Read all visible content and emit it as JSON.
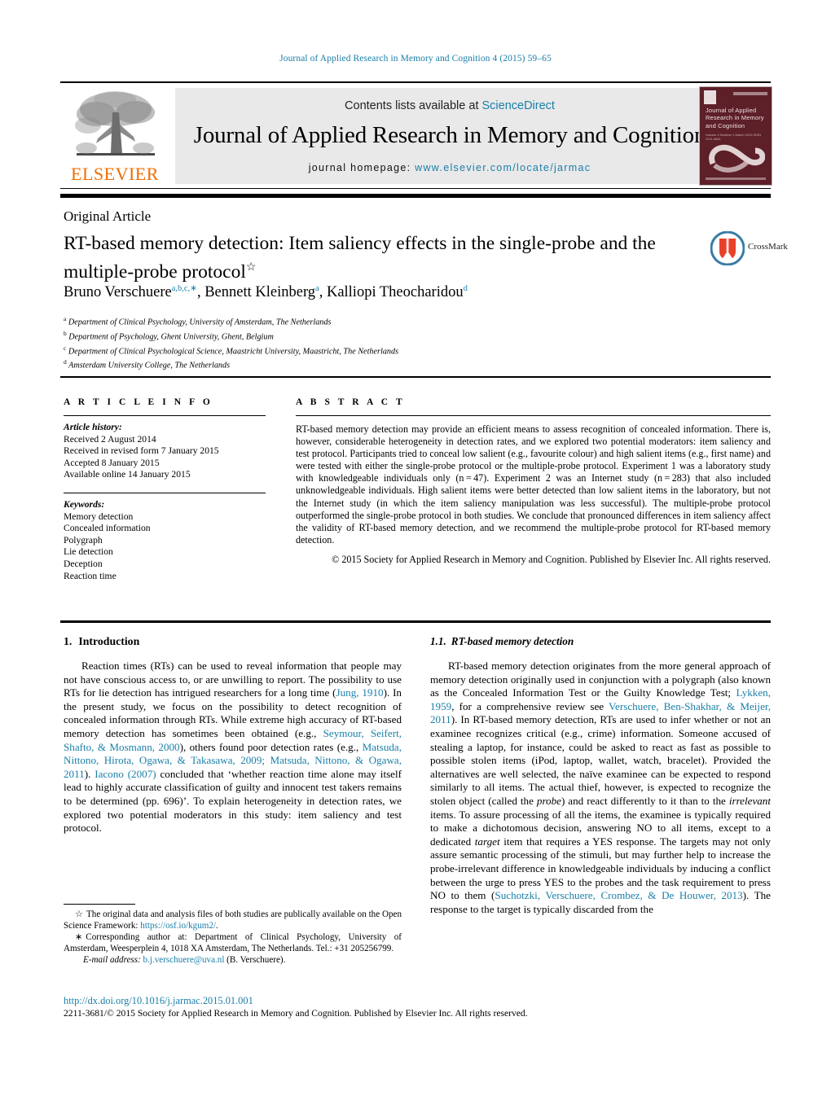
{
  "running_head": "Journal of Applied Research in Memory and Cognition 4 (2015) 59–65",
  "masthead": {
    "contents_prefix": "Contents lists available at ",
    "sciencedirect": "ScienceDirect",
    "journal_title": "Journal of Applied Research in Memory and Cognition",
    "homepage_prefix": "journal homepage: ",
    "homepage_url": "www.elsevier.com/locate/jarmac",
    "elsevier_wordmark": "ELSEVIER",
    "cover": {
      "title": "Journal of Applied Research in Memory and Cognition",
      "label": "Journal of",
      "sub": "Volume 4  Number 1  March 2015\nISSN 2211-3681"
    },
    "colors": {
      "link": "#1a7fa8",
      "elsevier_orange": "#f06c00",
      "panel_bg": "#e9e9e9",
      "cover_bg": "#5d1f28"
    }
  },
  "article": {
    "type": "Original Article",
    "title": "RT-based memory detection: Item saliency effects in the single-probe and the multiple-probe protocol",
    "title_footnote_mark": "☆",
    "crossmark_label": "CrossMark",
    "authors_html": "Bruno Verschuere<sup>a,b,c,∗</sup>, Bennett Kleinberg<sup>a</sup>, Kalliopi Theocharidou<sup>d</sup>",
    "affiliations": [
      {
        "mark": "a",
        "text": "Department of Clinical Psychology, University of Amsterdam, The Netherlands"
      },
      {
        "mark": "b",
        "text": "Department of Psychology, Ghent University, Ghent, Belgium"
      },
      {
        "mark": "c",
        "text": "Department of Clinical Psychological Science, Maastricht University, Maastricht, The Netherlands"
      },
      {
        "mark": "d",
        "text": "Amsterdam University College, The Netherlands"
      }
    ]
  },
  "article_info": {
    "heading": "A R T I C L E   I N F O",
    "history_label": "Article history:",
    "history": [
      "Received 2 August 2014",
      "Received in revised form 7 January 2015",
      "Accepted 8 January 2015",
      "Available online 14 January 2015"
    ],
    "keywords_label": "Keywords:",
    "keywords": [
      "Memory detection",
      "Concealed information",
      "Polygraph",
      "Lie detection",
      "Deception",
      "Reaction time"
    ]
  },
  "abstract": {
    "heading": "A B S T R A C T",
    "body": "RT-based memory detection may provide an efficient means to assess recognition of concealed information. There is, however, considerable heterogeneity in detection rates, and we explored two potential moderators: item saliency and test protocol. Participants tried to conceal low salient (e.g., favourite colour) and high salient items (e.g., first name) and were tested with either the single-probe protocol or the multiple-probe protocol. Experiment 1 was a laboratory study with knowledgeable individuals only (n = 47). Experiment 2 was an Internet study (n = 283) that also included unknowledgeable individuals. High salient items were better detected than low salient items in the laboratory, but not the Internet study (in which the item saliency manipulation was less successful). The multiple-probe protocol outperformed the single-probe protocol in both studies. We conclude that pronounced differences in item saliency affect the validity of RT-based memory detection, and we recommend the multiple-probe protocol for RT-based memory detection.",
    "copyright": "© 2015 Society for Applied Research in Memory and Cognition. Published by Elsevier Inc. All rights reserved."
  },
  "sections": {
    "intro": {
      "number": "1.",
      "title": "Introduction",
      "paragraph_parts": [
        {
          "t": "Reaction times (RTs) can be used to reveal information that people may not have conscious access to, or are unwilling to report. The possibility to use RTs for lie detection has intrigued researchers for a long time ("
        },
        {
          "t": "Jung, 1910",
          "link": true
        },
        {
          "t": "). In the present study, we focus on the possibility to detect recognition of concealed information through RTs. While extreme high accuracy of RT-based memory detection has sometimes been obtained (e.g., "
        },
        {
          "t": "Seymour, Seifert, Shafto, & Mosmann, 2000",
          "link": true
        },
        {
          "t": "), others found poor detection rates (e.g., "
        },
        {
          "t": "Matsuda, Nittono, Hirota, Ogawa, & Takasawa, 2009; Matsuda, Nittono, & Ogawa, 2011",
          "link": true
        },
        {
          "t": "). "
        },
        {
          "t": "Iacono (2007)",
          "link": true
        },
        {
          "t": " concluded that ‘whether reaction time alone may itself lead to highly accurate classification of guilty and innocent test takers remains to be determined (pp. 696)’. To explain heterogeneity in detection rates, we explored two potential moderators in this study: item saliency and test protocol."
        }
      ]
    },
    "rt_based": {
      "number": "1.1.",
      "title": "RT-based memory detection",
      "paragraph_parts": [
        {
          "t": "RT-based memory detection originates from the more general approach of memory detection originally used in conjunction with a polygraph (also known as the Concealed Information Test or the Guilty Knowledge Test; "
        },
        {
          "t": "Lykken, 1959",
          "link": true
        },
        {
          "t": ", for a comprehensive review see "
        },
        {
          "t": "Verschuere, Ben-Shakhar, & Meijer, 2011",
          "link": true
        },
        {
          "t": "). In RT-based memory detection, RTs are used to infer whether or not an examinee recognizes critical (e.g., crime) information. Someone accused of stealing a laptop, for instance, could be asked to react as fast as possible to possible stolen items (iPod, laptop, wallet, watch, bracelet). Provided the alternatives are well selected, the naïve examinee can be expected to respond similarly to all items. The actual thief, however, is expected to recognize the stolen object (called the "
        },
        {
          "t": "probe",
          "italic": true
        },
        {
          "t": ") and react differently to it than to the "
        },
        {
          "t": "irrelevant",
          "italic": true
        },
        {
          "t": " items. To assure processing of all the items, the examinee is typically required to make a dichotomous decision, answering NO to all items, except to a dedicated "
        },
        {
          "t": "target",
          "italic": true
        },
        {
          "t": " item that requires a YES response. The targets may not only assure semantic processing of the stimuli, but may further help to increase the probe-irrelevant difference in knowledgeable individuals by inducing a conflict between the urge to press YES to the probes and the task requirement to press NO to them ("
        },
        {
          "t": "Suchotzki, Verschuere, Crombez, & De Houwer, 2013",
          "link": true
        },
        {
          "t": "). The response to the target is typically discarded from the"
        }
      ]
    }
  },
  "footnotes": [
    {
      "mark": "☆",
      "parts": [
        {
          "t": "The original data and analysis files of both studies are publically available on the Open Science Framework: "
        },
        {
          "t": "https://osf.io/kgum2/",
          "link": true
        },
        {
          "t": "."
        }
      ]
    },
    {
      "mark": "∗",
      "parts": [
        {
          "t": "Corresponding author at: Department of Clinical Psychology, University of Amsterdam, Weesperplein 4, 1018 XA Amsterdam, The Netherlands. Tel.: +31 205256799."
        }
      ]
    },
    {
      "mark": "",
      "email_label": "E-mail address:",
      "parts": [
        {
          "t": "b.j.verschuere@uva.nl",
          "link": true
        },
        {
          "t": " (B. Verschuere)."
        }
      ]
    }
  ],
  "footer": {
    "doi": "http://dx.doi.org/10.1016/j.jarmac.2015.01.001",
    "issn_line": "2211-3681/© 2015 Society for Applied Research in Memory and Cognition. Published by Elsevier Inc. All rights reserved."
  }
}
